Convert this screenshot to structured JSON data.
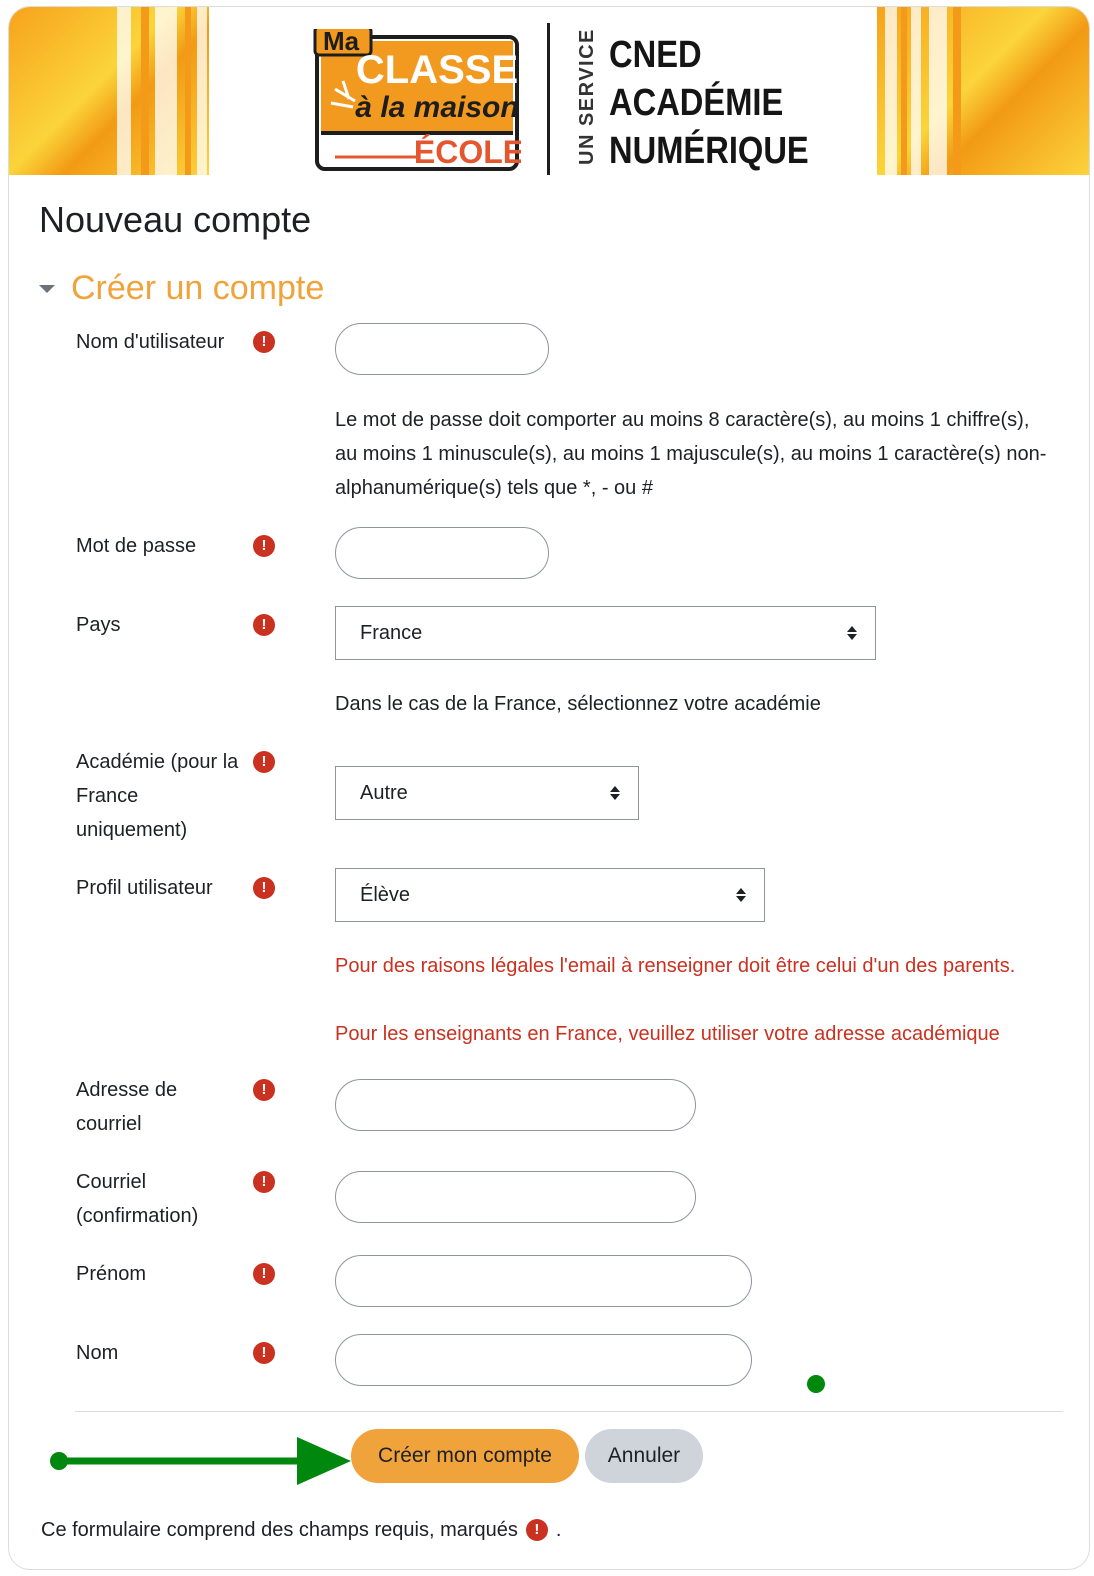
{
  "banner": {
    "logo_line1": "Ma",
    "logo_line2": "CLASSE",
    "logo_line3": "à la maison",
    "logo_line4": "ÉCOLE",
    "service_label": "UN SERVICE",
    "brand_lines": [
      "CNED",
      "ACADÉMIE",
      "NUMÉRIQUE"
    ],
    "accent_color": "#f0a33a"
  },
  "page_title": "Nouveau compte",
  "section_title": "Créer un compte",
  "fields": {
    "username": {
      "label": "Nom d'utilisateur",
      "value": ""
    },
    "password_policy": "Le mot de passe doit comporter au moins 8 caractère(s), au moins 1 chiffre(s), au moins 1 minuscule(s), au moins 1 majuscule(s), au moins 1 caractère(s) non-alphanumérique(s) tels que *, - ou #",
    "password": {
      "label": "Mot de passe",
      "value": ""
    },
    "country": {
      "label": "Pays",
      "selected": "France"
    },
    "country_help": "Dans le cas de la France, sélectionnez votre académie",
    "academy": {
      "label": "Académie (pour la France uniquement)",
      "selected": "Autre"
    },
    "profile": {
      "label": "Profil utilisateur",
      "selected": "Élève"
    },
    "legal_note_1": "Pour des raisons légales l'email à renseigner doit être celui d'un des parents.",
    "legal_note_2": "Pour les enseignants en France, veuillez utiliser votre adresse académique",
    "email": {
      "label": "Adresse de courriel",
      "value": ""
    },
    "email_confirm": {
      "label": "Courriel (confirmation)",
      "value": ""
    },
    "firstname": {
      "label": "Prénom",
      "value": ""
    },
    "lastname": {
      "label": "Nom",
      "value": ""
    }
  },
  "required_icon": "!",
  "buttons": {
    "submit": "Créer mon compte",
    "cancel": "Annuler"
  },
  "footer_note": "Ce formulaire comprend des champs requis, marqués",
  "footer_period": "."
}
